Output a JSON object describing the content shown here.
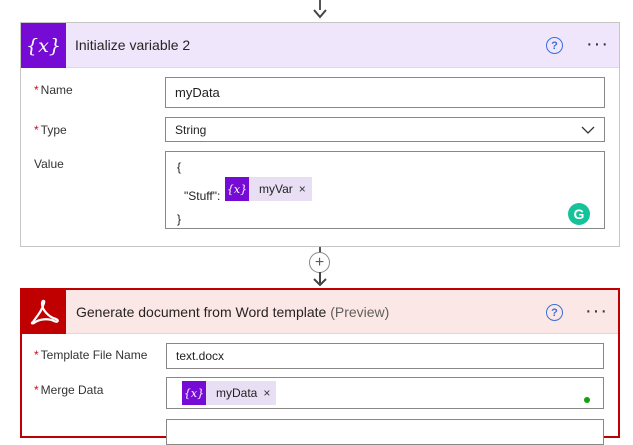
{
  "card1": {
    "title": "Initialize variable 2",
    "icon_text": "{x}",
    "name_label": "Name",
    "name_value": "myData",
    "type_label": "Type",
    "type_value": "String",
    "value_label": "Value",
    "value_lines": [
      "{",
      "\"Stuff\":",
      "}"
    ],
    "token": {
      "label": "myVar",
      "icon_text": "{x}"
    }
  },
  "card2": {
    "title": "Generate document from Word template",
    "title_suffix": "(Preview)",
    "template_label": "Template File Name",
    "template_value": "text.docx",
    "merge_label": "Merge Data",
    "token": {
      "label": "myData",
      "icon_text": "{x}"
    }
  },
  "common": {
    "required_mark": "*",
    "help_glyph": "?",
    "more_glyph": "···",
    "remove_glyph": "×",
    "add_glyph": "+",
    "grammarly_glyph": "G"
  },
  "colors": {
    "variable_accent": "#770bd6",
    "pdf_accent": "#c00000",
    "grammarly": "#15c39a"
  },
  "icons": [
    "arrow-down-icon",
    "variable-icon",
    "help-icon",
    "more-options-icon",
    "chevron-down-icon",
    "close-icon",
    "grammarly-icon",
    "plus-icon",
    "adobe-pdf-icon"
  ]
}
